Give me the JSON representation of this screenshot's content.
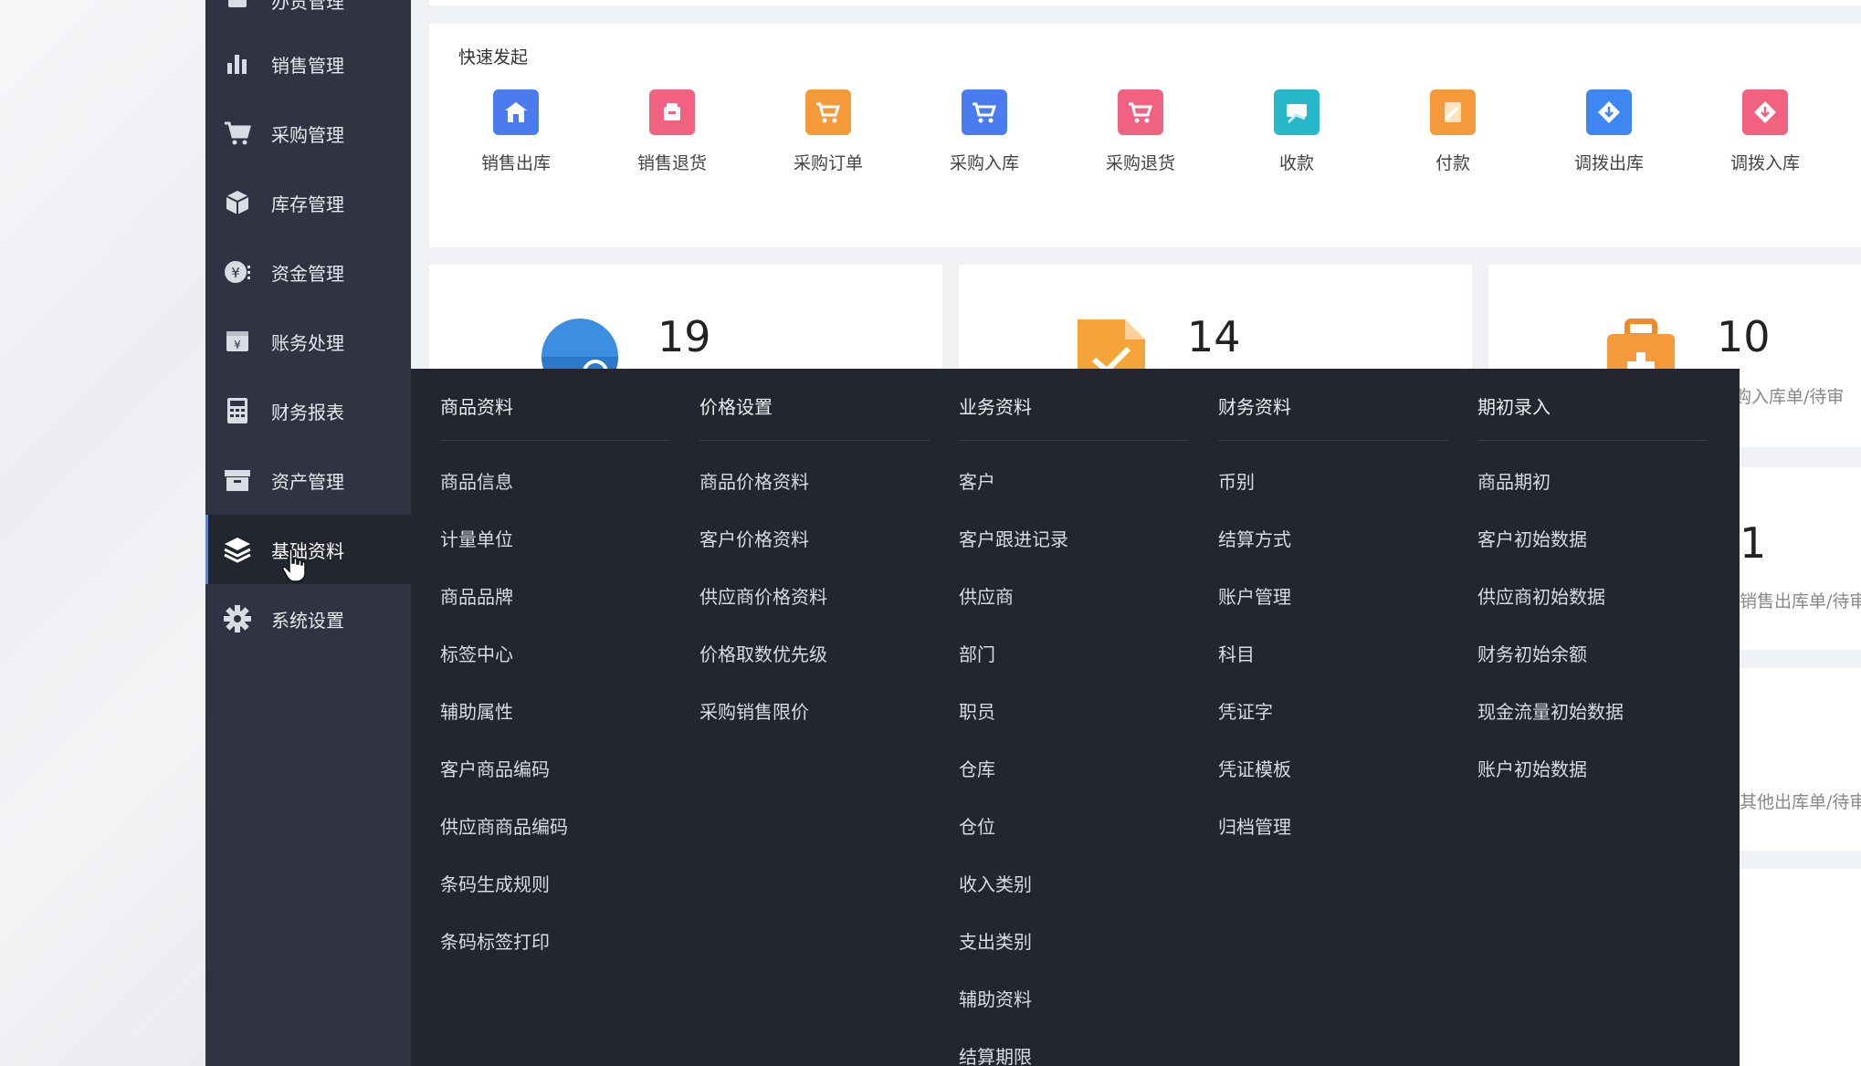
{
  "sidebar": {
    "items": [
      {
        "label": "办货管理",
        "icon": "document-icon"
      },
      {
        "label": "销售管理",
        "icon": "bar-chart-icon"
      },
      {
        "label": "采购管理",
        "icon": "cart-icon"
      },
      {
        "label": "库存管理",
        "icon": "box-icon"
      },
      {
        "label": "资金管理",
        "icon": "yen-coin-icon"
      },
      {
        "label": "账务处理",
        "icon": "ledger-icon"
      },
      {
        "label": "财务报表",
        "icon": "calculator-icon"
      },
      {
        "label": "资产管理",
        "icon": "archive-icon"
      },
      {
        "label": "基础资料",
        "icon": "layers-icon"
      },
      {
        "label": "系统设置",
        "icon": "gear-icon"
      }
    ],
    "active_index": 8
  },
  "quick_start": {
    "title": "快速发起",
    "items": [
      {
        "label": "销售出库",
        "color": "#4a7cf0"
      },
      {
        "label": "销售退货",
        "color": "#f0627f"
      },
      {
        "label": "采购订单",
        "color": "#f59a3a"
      },
      {
        "label": "采购入库",
        "color": "#4a7cf0"
      },
      {
        "label": "采购退货",
        "color": "#f0627f"
      },
      {
        "label": "收款",
        "color": "#26b7c9"
      },
      {
        "label": "付款",
        "color": "#f59a3a"
      },
      {
        "label": "调拨出库",
        "color": "#3f86f2"
      },
      {
        "label": "调拨入库",
        "color": "#f0627f"
      }
    ]
  },
  "stats": [
    {
      "value": "19"
    },
    {
      "value": "14"
    },
    {
      "value": "10",
      "subtitle": "采购入库单/待审"
    }
  ],
  "mini_cards": [
    {
      "value": "1",
      "subtitle": "销售出库单/待审"
    },
    {
      "subtitle": "其他出库单/待审"
    }
  ],
  "dropdown": {
    "columns": [
      {
        "title": "商品资料",
        "links": [
          "商品信息",
          "计量单位",
          "商品品牌",
          "标签中心",
          "辅助属性",
          "客户商品编码",
          "供应商商品编码",
          "条码生成规则",
          "条码标签打印"
        ]
      },
      {
        "title": "价格设置",
        "links": [
          "商品价格资料",
          "客户价格资料",
          "供应商价格资料",
          "价格取数优先级",
          "采购销售限价"
        ]
      },
      {
        "title": "业务资料",
        "links": [
          "客户",
          "客户跟进记录",
          "供应商",
          "部门",
          "职员",
          "仓库",
          "仓位",
          "收入类别",
          "支出类别",
          "辅助资料",
          "结算期限"
        ]
      },
      {
        "title": "财务资料",
        "links": [
          "币别",
          "结算方式",
          "账户管理",
          "科目",
          "凭证字",
          "凭证模板",
          "归档管理"
        ]
      },
      {
        "title": "期初录入",
        "links": [
          "商品期初",
          "客户初始数据",
          "供应商初始数据",
          "财务初始余额",
          "现金流量初始数据",
          "账户初始数据"
        ]
      }
    ]
  },
  "colors": {
    "sidebar_bg": "#2f3342",
    "dropdown_bg": "#23262f",
    "accent": "#3d8af7"
  }
}
